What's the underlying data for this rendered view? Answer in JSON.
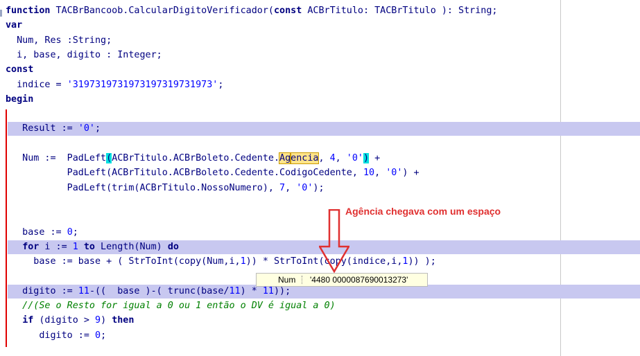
{
  "editor": {
    "lines": [
      [
        [
          "k",
          "function"
        ],
        [
          "t",
          " TACBrBancoob.CalcularDigitoVerificador("
        ],
        [
          "k",
          "const"
        ],
        [
          "t",
          " ACBrTitulo: TACBrTitulo ): String;"
        ]
      ],
      [
        [
          "k",
          "var"
        ]
      ],
      [
        [
          "t",
          "  Num, Res :String;"
        ]
      ],
      [
        [
          "t",
          "  i, base, digito : Integer;"
        ]
      ],
      [
        [
          "k",
          "const"
        ]
      ],
      [
        [
          "t",
          "  indice = "
        ],
        [
          "s",
          "'3197319731973197319731973'"
        ],
        [
          "t",
          ";"
        ]
      ],
      [
        [
          "k",
          "begin"
        ]
      ],
      [],
      [
        [
          "t",
          "   Result := "
        ],
        [
          "s",
          "'0'"
        ],
        [
          "t",
          ";"
        ]
      ],
      [],
      [
        [
          "t",
          "   Num :=  PadLeft"
        ],
        [
          "bm",
          "("
        ],
        [
          "t",
          "ACBrTitulo.ACBrBoleto.Cedente."
        ],
        [
          "sel",
          "Ag"
        ],
        [
          "caret",
          ""
        ],
        [
          "sel",
          "encia"
        ],
        [
          "t",
          ", "
        ],
        [
          "n",
          "4"
        ],
        [
          "t",
          ", "
        ],
        [
          "s",
          "'0'"
        ],
        [
          "bm",
          ")"
        ],
        [
          "t",
          " +"
        ]
      ],
      [
        [
          "t",
          "           PadLeft(ACBrTitulo.ACBrBoleto.Cedente.CodigoCedente, "
        ],
        [
          "n",
          "10"
        ],
        [
          "t",
          ", "
        ],
        [
          "s",
          "'0'"
        ],
        [
          "t",
          ") +"
        ]
      ],
      [
        [
          "t",
          "           PadLeft(trim(ACBrTitulo.NossoNumero), "
        ],
        [
          "n",
          "7"
        ],
        [
          "t",
          ", "
        ],
        [
          "s",
          "'0'"
        ],
        [
          "t",
          ");"
        ]
      ],
      [],
      [],
      [
        [
          "t",
          "   base := "
        ],
        [
          "n",
          "0"
        ],
        [
          "t",
          ";"
        ]
      ],
      [
        [
          "t",
          "   "
        ],
        [
          "k",
          "for"
        ],
        [
          "t",
          " i := "
        ],
        [
          "n",
          "1"
        ],
        [
          "t",
          " "
        ],
        [
          "k",
          "to"
        ],
        [
          "t",
          " Length(Num) "
        ],
        [
          "k",
          "do"
        ]
      ],
      [
        [
          "t",
          "     base := base + ( StrToInt(copy(Num,i,"
        ],
        [
          "n",
          "1"
        ],
        [
          "t",
          ")) * StrToInt(copy(indice,i,"
        ],
        [
          "n",
          "1"
        ],
        [
          "t",
          ")) );"
        ]
      ],
      [],
      [
        [
          "t",
          "   digito := "
        ],
        [
          "n",
          "11"
        ],
        [
          "t",
          "-((  base )-( trunc(base/"
        ],
        [
          "n",
          "11"
        ],
        [
          "t",
          ") * "
        ],
        [
          "n",
          "11"
        ],
        [
          "t",
          "));"
        ]
      ],
      [
        [
          "c",
          "   //(Se o Resto for igual a 0 ou 1 então o DV é igual a 0)"
        ]
      ],
      [
        [
          "t",
          "   "
        ],
        [
          "k",
          "if"
        ],
        [
          "t",
          " (digito > "
        ],
        [
          "n",
          "9"
        ],
        [
          "t",
          ") "
        ],
        [
          "k",
          "then"
        ]
      ],
      [
        [
          "t",
          "      digito := "
        ],
        [
          "n",
          "0"
        ],
        [
          "t",
          ";"
        ]
      ]
    ],
    "highlighted_lines": [
      8,
      16,
      19
    ]
  },
  "annotation": {
    "text": "Agência chegava com um espaço",
    "color": "#e03030"
  },
  "tooltip": {
    "name": "Num",
    "value": "'4480 0000087690013273'"
  }
}
